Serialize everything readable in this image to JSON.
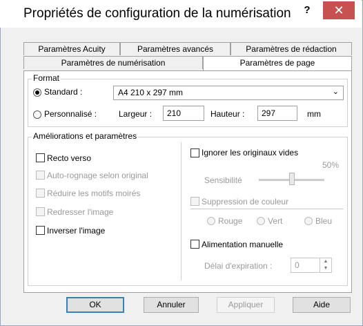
{
  "window": {
    "title": "Propriétés de configuration de la numérisation",
    "help_label": "?",
    "close_label": "✕"
  },
  "tabs": {
    "row1": [
      {
        "label": "Paramètres Acuity"
      },
      {
        "label": "Paramètres avancés"
      },
      {
        "label": "Paramètres de rédaction"
      }
    ],
    "row2": [
      {
        "label": "Paramètres de numérisation"
      },
      {
        "label": "Paramètres de page",
        "active": true
      }
    ]
  },
  "format": {
    "legend": "Format",
    "standard_label": "Standard :",
    "standard_checked": true,
    "standard_value": "A4 210 x 297 mm",
    "custom_label": "Personnalisé :",
    "custom_checked": false,
    "width_label": "Largeur :",
    "width_value": "210",
    "height_label": "Hauteur :",
    "height_value": "297",
    "unit": "mm"
  },
  "enhancements": {
    "legend": "Améliorations et paramètres",
    "left": [
      {
        "label": "Recto verso",
        "enabled": true,
        "checked": false
      },
      {
        "label": "Auto-rognage selon original",
        "enabled": false,
        "checked": false
      },
      {
        "label": "Réduire les motifs moirés",
        "enabled": false,
        "checked": false
      },
      {
        "label": "Redresser l'image",
        "enabled": false,
        "checked": false
      },
      {
        "label": "Inverser l'image",
        "enabled": true,
        "checked": false
      }
    ],
    "ignore_blank": {
      "label": "Ignorer les originaux vides",
      "checked": false
    },
    "sensitivity_label": "Sensibilité",
    "sensitivity_value": "50%",
    "sensitivity_level": 0.5,
    "color_dropout": {
      "label": "Suppression de couleur",
      "enabled": false
    },
    "colors": [
      "Rouge",
      "Vert",
      "Bleu"
    ],
    "manual_feed": {
      "label": "Alimentation manuelle",
      "checked": false
    },
    "timeout_label": "Délai d'expiration :",
    "timeout_value": "0"
  },
  "buttons": {
    "ok": "OK",
    "cancel": "Annuler",
    "apply": "Appliquer",
    "help": "Aide"
  }
}
